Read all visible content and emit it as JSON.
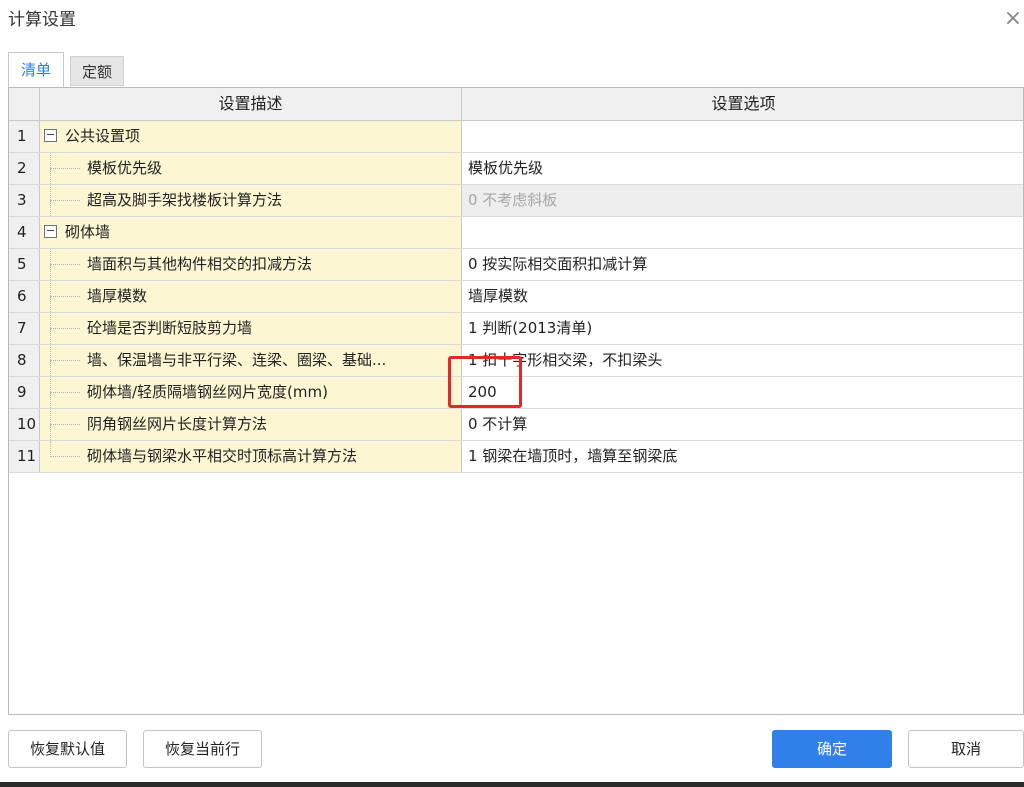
{
  "window": {
    "title": "计算设置",
    "close_glyph": "×"
  },
  "tabs": [
    {
      "label": "清单",
      "active": true
    },
    {
      "label": "定额",
      "active": false
    }
  ],
  "grid": {
    "columns": [
      "设置描述",
      "设置选项"
    ],
    "rows": [
      {
        "num": "1",
        "group": true,
        "toggle": "−",
        "desc": "公共设置项",
        "value": ""
      },
      {
        "num": "2",
        "group": false,
        "desc": "模板优先级",
        "value": "模板优先级"
      },
      {
        "num": "3",
        "group": false,
        "desc": "超高及脚手架找楼板计算方法",
        "value": "0 不考虑斜板",
        "disabled": true
      },
      {
        "num": "4",
        "group": true,
        "toggle": "−",
        "desc": "砌体墙",
        "value": ""
      },
      {
        "num": "5",
        "group": false,
        "desc": "墙面积与其他构件相交的扣减方法",
        "value": "0 按实际相交面积扣减计算"
      },
      {
        "num": "6",
        "group": false,
        "desc": "墙厚模数",
        "value": "墙厚模数"
      },
      {
        "num": "7",
        "group": false,
        "desc": "砼墙是否判断短肢剪力墙",
        "value": "1 判断(2013清单)"
      },
      {
        "num": "8",
        "group": false,
        "desc": "墙、保温墙与非平行梁、连梁、圈梁、基础...",
        "value": "1 扣十字形相交梁，不扣梁头"
      },
      {
        "num": "9",
        "group": false,
        "desc": "砌体墙/轻质隔墙钢丝网片宽度(mm)",
        "value": "200"
      },
      {
        "num": "10",
        "group": false,
        "desc": "阴角钢丝网片长度计算方法",
        "value": "0 不计算"
      },
      {
        "num": "11",
        "group": false,
        "desc": "砌体墙与钢梁水平相交时顶标高计算方法",
        "value": "1 钢梁在墙顶时，墙算至钢梁底"
      }
    ]
  },
  "buttons": {
    "restore_default": "恢复默认值",
    "restore_current": "恢复当前行",
    "ok": "确定",
    "cancel": "取消"
  },
  "colors": {
    "accent": "#2f80e8",
    "highlight": "#e02a2a",
    "desc_bg": "#fdf6d3"
  }
}
